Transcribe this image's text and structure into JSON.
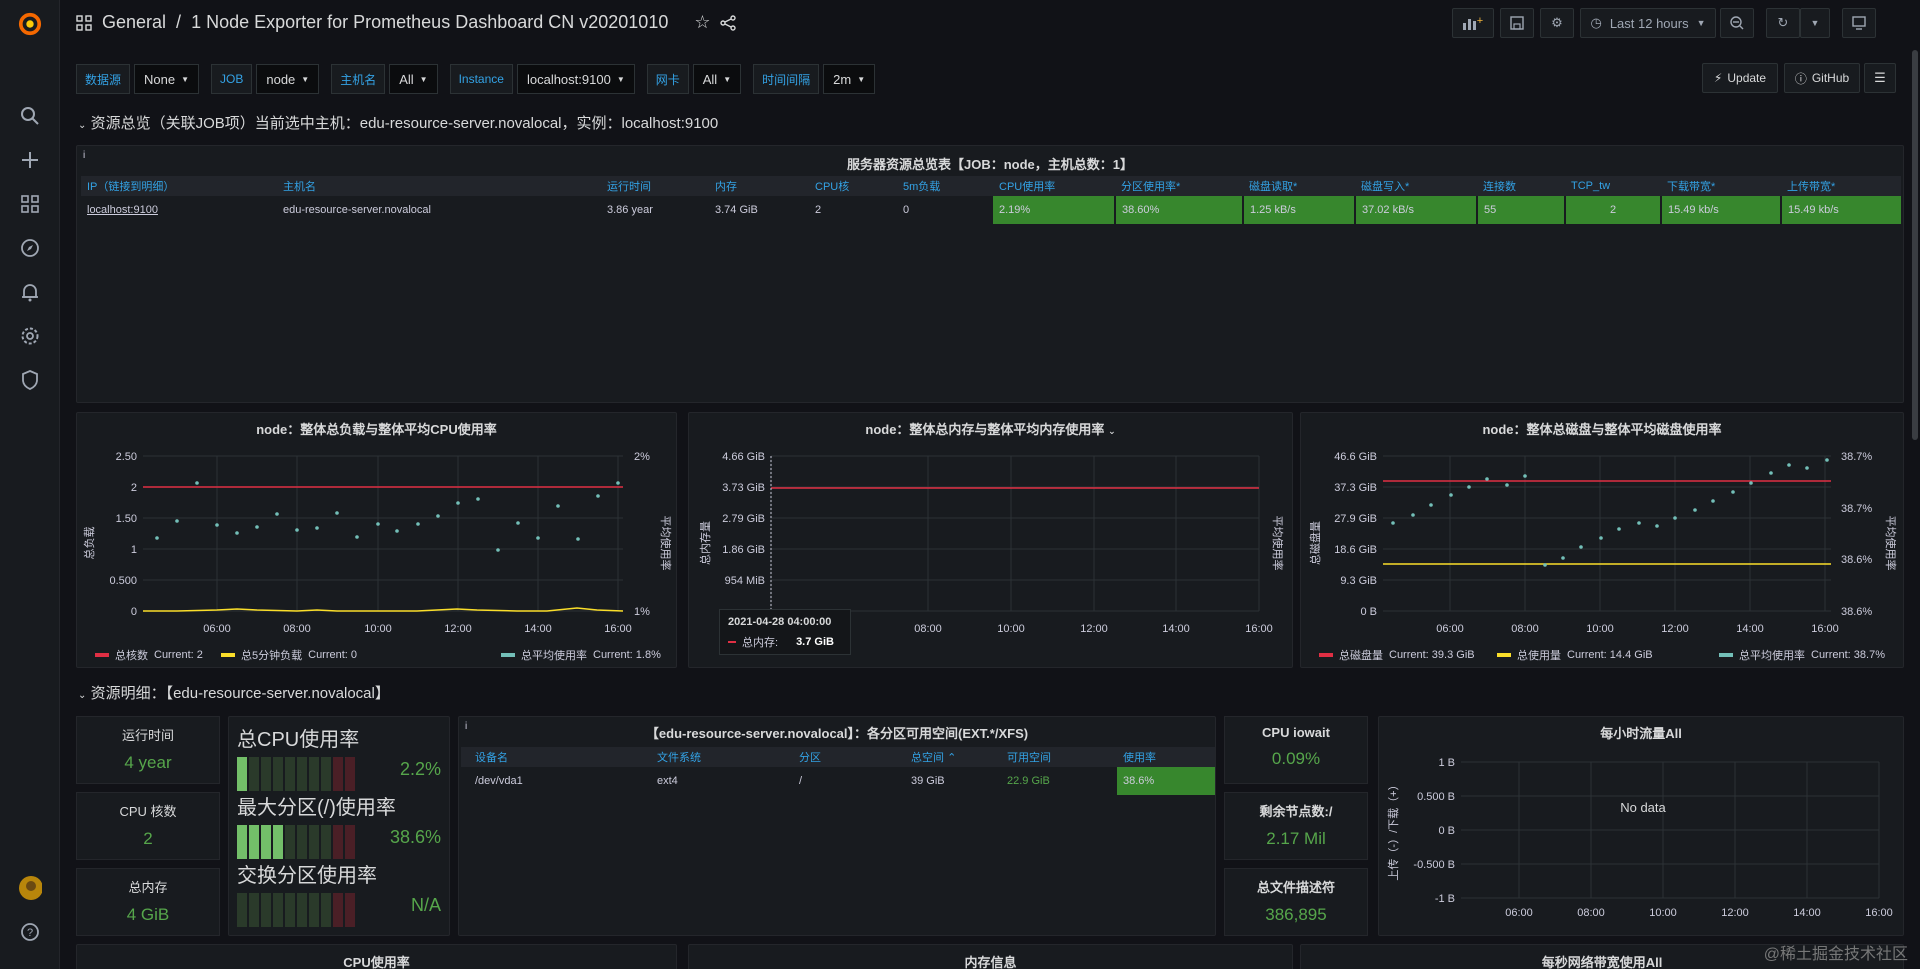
{
  "breadcrumb": {
    "folder": "General",
    "separator": "/",
    "title": "1 Node Exporter for Prometheus Dashboard CN v20201010"
  },
  "toolbar": {
    "time_range": "Last 12 hours",
    "update_label": "Update",
    "github_label": "GitHub"
  },
  "variables": [
    {
      "label": "数据源",
      "value": "None"
    },
    {
      "label": "JOB",
      "value": "node"
    },
    {
      "label": "主机名",
      "value": "All"
    },
    {
      "label": "Instance",
      "value": "localhost:9100"
    },
    {
      "label": "网卡",
      "value": "All"
    },
    {
      "label": "时间间隔",
      "value": "2m"
    }
  ],
  "row1_title": "资源总览（关联JOB项）当前选中主机：edu-resource-server.novalocal，实例：localhost:9100",
  "row2_title": "资源明细：【edu-resource-server.novalocal】",
  "overview_table": {
    "title": "服务器资源总览表【JOB：node，主机总数：1】",
    "headers": [
      "IP（链接到明细）",
      "主机名",
      "运行时间",
      "内存",
      "CPU核",
      "5m负载",
      "CPU使用率",
      "分区使用率*",
      "磁盘读取*",
      "磁盘写入*",
      "连接数",
      "TCP_tw",
      "下载带宽*",
      "上传带宽*"
    ],
    "row": [
      "localhost:9100",
      "edu-resource-server.novalocal",
      "3.86 year",
      "3.74 GiB",
      "2",
      "0",
      "2.19%",
      "38.60%",
      "1.25 kB/s",
      "37.02 kB/s",
      "55",
      "2",
      "15.49 kb/s",
      "15.49 kb/s"
    ]
  },
  "charts": {
    "cpu": {
      "title": "node：整体总负载与整体平均CPU使用率",
      "ylabel_left": "总负载",
      "ylabel_right": "平均使用率",
      "yticks_left": [
        "2.50",
        "2",
        "1.50",
        "1",
        "0.500",
        "0"
      ],
      "yticks_right": [
        "2%",
        "1%"
      ],
      "xticks": [
        "06:00",
        "08:00",
        "10:00",
        "12:00",
        "14:00",
        "16:00"
      ],
      "legend": [
        {
          "name": "总核数",
          "current": "Current: 2",
          "color": "#e02f44"
        },
        {
          "name": "总5分钟负载",
          "current": "Current: 0",
          "color": "#fade2a"
        },
        {
          "name": "总平均使用率",
          "current": "Current: 1.8%",
          "color": "#73bfb8"
        }
      ]
    },
    "mem": {
      "title": "node：整体总内存与整体平均内存使用率",
      "ylabel_left": "总内存量",
      "ylabel_right": "平均使用率",
      "yticks_left": [
        "4.66 GiB",
        "3.73 GiB",
        "2.79 GiB",
        "1.86 GiB",
        "954 MiB"
      ],
      "xticks": [
        "08:00",
        "10:00",
        "12:00",
        "14:00",
        "16:00"
      ],
      "tooltip": {
        "time": "2021-04-28 04:00:00",
        "name": "总内存:",
        "value": "3.7 GiB"
      }
    },
    "disk": {
      "title": "node：整体总磁盘与整体平均磁盘使用率",
      "ylabel_left": "总磁盘量",
      "ylabel_right": "平均使用率",
      "yticks_left": [
        "46.6 GiB",
        "37.3 GiB",
        "27.9 GiB",
        "18.6 GiB",
        "9.3 GiB",
        "0 B"
      ],
      "yticks_right": [
        "38.7%",
        "38.7%",
        "38.6%",
        "38.6%"
      ],
      "xticks": [
        "06:00",
        "08:00",
        "10:00",
        "12:00",
        "14:00",
        "16:00"
      ],
      "legend": [
        {
          "name": "总磁盘量",
          "current": "Current: 39.3 GiB",
          "color": "#e02f44"
        },
        {
          "name": "总使用量",
          "current": "Current: 14.4 GiB",
          "color": "#fade2a"
        },
        {
          "name": "总平均使用率",
          "current": "Current: 38.7%",
          "color": "#73bfb8"
        }
      ]
    }
  },
  "stats": {
    "uptime": {
      "label": "运行时间",
      "value": "4 year"
    },
    "cores": {
      "label": "CPU 核数",
      "value": "2"
    },
    "memory": {
      "label": "总内存",
      "value": "4 GiB"
    },
    "iowait": {
      "label": "CPU iowait",
      "value": "0.09%"
    },
    "inodes": {
      "label": "剩余节点数:/",
      "value": "2.17 Mil"
    },
    "fd": {
      "label": "总文件描述符",
      "value": "386,895"
    }
  },
  "gauges": [
    {
      "label": "总CPU使用率",
      "value": "2.2%",
      "level": 0.022
    },
    {
      "label": "最大分区(/)使用率",
      "value": "38.6%",
      "level": 0.386
    },
    {
      "label": "交换分区使用率",
      "value": "N/A",
      "level": 0
    }
  ],
  "partition_table": {
    "title": "【edu-resource-server.novalocal】：各分区可用空间(EXT.*/XFS)",
    "headers": [
      "设备名",
      "文件系统",
      "分区",
      "总空间",
      "可用空间",
      "使用率"
    ],
    "row": [
      "/dev/vda1",
      "ext4",
      "/",
      "39 GiB",
      "22.9 GiB",
      "38.6%"
    ]
  },
  "traffic": {
    "title": "每小时流量All",
    "no_data": "No data",
    "ylabel": "上传（-）/下载（+）",
    "yticks": [
      "1 B",
      "0.500 B",
      "0 B",
      "-0.500 B",
      "-1 B"
    ],
    "xticks": [
      "06:00",
      "08:00",
      "10:00",
      "12:00",
      "14:00",
      "16:00"
    ]
  },
  "bottom_titles": [
    "CPU使用率",
    "内存信息",
    "每秒网络带宽使用All"
  ],
  "watermark": "@稀土掘金技术社区"
}
